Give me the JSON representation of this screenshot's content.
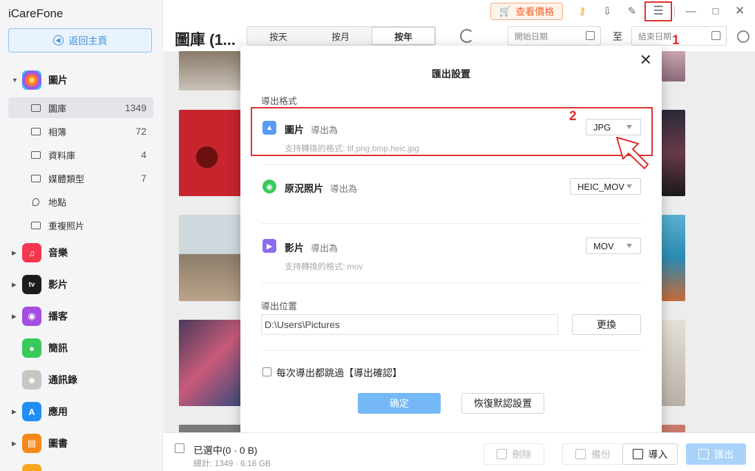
{
  "app": {
    "title": "iCareFone"
  },
  "sidebar": {
    "home_label": "返回主頁",
    "photos": {
      "label": "圖片",
      "items": [
        {
          "label": "圖庫",
          "count": "1349"
        },
        {
          "label": "相簿",
          "count": "72"
        },
        {
          "label": "資料庫",
          "count": "4"
        },
        {
          "label": "媒體類型",
          "count": "7"
        },
        {
          "label": "地點",
          "count": ""
        },
        {
          "label": "重複照片",
          "count": ""
        }
      ]
    },
    "categories": [
      {
        "label": "音樂",
        "icon": "music-icon",
        "color": "#f5364f"
      },
      {
        "label": "影片",
        "icon": "appletv-icon",
        "color": "#1c1c1e"
      },
      {
        "label": "播客",
        "icon": "podcast-icon",
        "color": "#a44ee0"
      },
      {
        "label": "簡訊",
        "icon": "messages-icon",
        "color": "#38c95a"
      },
      {
        "label": "通訊錄",
        "icon": "contacts-icon",
        "color": "#c9c6c2"
      },
      {
        "label": "應用",
        "icon": "appstore-icon",
        "color": "#1f8ff5"
      },
      {
        "label": "圖書",
        "icon": "books-icon",
        "color": "#f7891c"
      }
    ]
  },
  "toolbar": {
    "price_label": "查看價格",
    "annotation_1": "1",
    "annotation_2": "2"
  },
  "header": {
    "title": "圖庫 (1...",
    "tabs": [
      "按天",
      "按月",
      "按年"
    ],
    "active_tab": "按年",
    "start_date_placeholder": "開始日期",
    "to_label": "至",
    "end_date_placeholder": "結束日期"
  },
  "dialog": {
    "title": "匯出設置",
    "format_section": "導出格式",
    "photo": {
      "name": "圖片",
      "sub": "導出為",
      "note": "支持轉換的格式: tif,png,bmp,heic,jpg",
      "value": "JPG"
    },
    "live": {
      "name": "原況照片",
      "sub": "導出為",
      "value": "HEIC_MOV"
    },
    "video": {
      "name": "影片",
      "sub": "導出為",
      "note": "支持轉換的格式: mov",
      "value": "MOV"
    },
    "location_section": "導出位置",
    "path": "D:\\Users\\Pictures",
    "change_label": "更換",
    "skip_label": "每次導出都跳過【導出確認】",
    "confirm_label": "确定",
    "reset_label": "恢復默認設置"
  },
  "bottombar": {
    "selected": "已選中(0 · 0 B)",
    "total": "總計: 1349 · 6.16 GB",
    "delete_label": "刪除",
    "backup_label": "備份",
    "import_label": "導入",
    "export_label": "匯出"
  },
  "colors": {
    "accent": "#3d8fe0",
    "annotation": "#e02b2b",
    "price": "#f0642c"
  }
}
